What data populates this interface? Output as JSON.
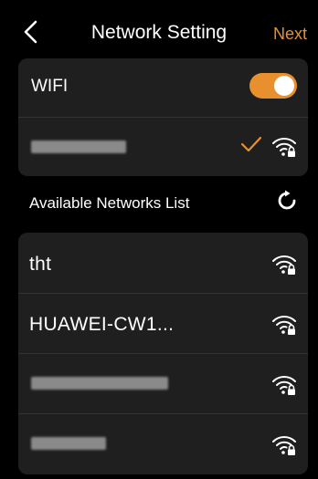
{
  "header": {
    "title": "Network Setting",
    "next_label": "Next"
  },
  "wifi": {
    "label": "WIFI",
    "enabled": true
  },
  "current_network": {
    "name": "",
    "connected": true,
    "secured": true
  },
  "available": {
    "label": "Available Networks List",
    "networks": [
      {
        "name": "tht",
        "secured": true
      },
      {
        "name": "HUAWEI-CW1...",
        "secured": true
      },
      {
        "name": "",
        "secured": true
      },
      {
        "name": "",
        "secured": true
      }
    ]
  },
  "colors": {
    "accent": "#E8902E",
    "background": "#000000",
    "card": "#1F1F1F"
  },
  "icons": [
    "back-arrow-icon",
    "check-icon",
    "wifi-lock-icon",
    "refresh-icon"
  ]
}
